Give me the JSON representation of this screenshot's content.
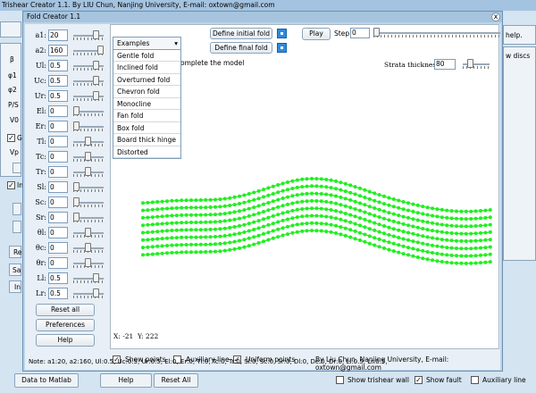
{
  "app": {
    "title": "Trishear Creator 1.1. By LIU Chun, Nanjing University, E-mail: oxtown@gmail.com",
    "right_partial_labels": [
      "help.",
      "w discs"
    ],
    "left_partial_labels": [
      "β",
      "φ1",
      "φ2",
      "P/S",
      "V0",
      "G",
      "Vp",
      "In",
      "Re",
      "Sa",
      "In"
    ],
    "bottom_buttons": {
      "data_to_matlab": "Data to Matlab",
      "help": "Help",
      "reset_all": "Reset All"
    },
    "bottom_checks": {
      "show_trishear_wall": "Show trishear wall",
      "show_fault": "Show fault",
      "auxiliary_line": "Auxiliary line"
    }
  },
  "dialog": {
    "title": "Fold Creator 1.1",
    "close_label": "x",
    "params": [
      {
        "label": "a1:",
        "value": "20"
      },
      {
        "label": "a2:",
        "value": "160"
      },
      {
        "label": "Ul:",
        "value": "0.5"
      },
      {
        "label": "Uc:",
        "value": "0.5"
      },
      {
        "label": "Ur:",
        "value": "0.5"
      },
      {
        "label": "El:",
        "value": "0"
      },
      {
        "label": "Er:",
        "value": "0"
      },
      {
        "label": "Tl:",
        "value": "0"
      },
      {
        "label": "Tc:",
        "value": "0"
      },
      {
        "label": "Tr:",
        "value": "0"
      },
      {
        "label": "Sl:",
        "value": "0"
      },
      {
        "label": "Sc:",
        "value": "0"
      },
      {
        "label": "Sr:",
        "value": "0"
      },
      {
        "label": "θl:",
        "value": "0"
      },
      {
        "label": "θc:",
        "value": "0"
      },
      {
        "label": "θr:",
        "value": "0"
      },
      {
        "label": "Ll:",
        "value": "0.5"
      },
      {
        "label": "Lr:",
        "value": "0.5"
      }
    ],
    "buttons": {
      "reset_all": "Reset all",
      "preferences": "Preferences",
      "help": "Help",
      "define_initial": "Define initial fold",
      "define_final": "Define final fold",
      "play": "Play"
    },
    "step": {
      "label": "Step:",
      "value": "0"
    },
    "examples": {
      "selected": "Examples",
      "items": [
        "Gentle fold",
        "Inclined fold",
        "Overturned fold",
        "Chevron fold",
        "Monocline",
        "Fan fold",
        "Box fold",
        "Board thick hinge",
        "Distorted"
      ]
    },
    "hint_partial": "omplete the model",
    "strata": {
      "label": "Strata thickness:",
      "value": "80"
    },
    "coords": {
      "x": "X: -21",
      "y": "Y: 222"
    },
    "checks": {
      "show_points": "Show points",
      "auxiliary_line": "Auxiliary line",
      "uniform_points": "Uniform points"
    },
    "credit": "By Liu Chun, Nanjing University, E-mail: oxtown@gmail.com",
    "note": "Note:  a1:20, a2:160, Ul:0.5, Uc:0.5, Ur:0.5, El:0, Er:0, Tl:0, Tc:0, Tr:0, Sl:0, Sc:0, Sr:0, Dl:0, Dc:0, Dr:0, Ll:0.5, Lr:0.5,",
    "fold_layers": 8,
    "fold_color": "#22ee22"
  }
}
